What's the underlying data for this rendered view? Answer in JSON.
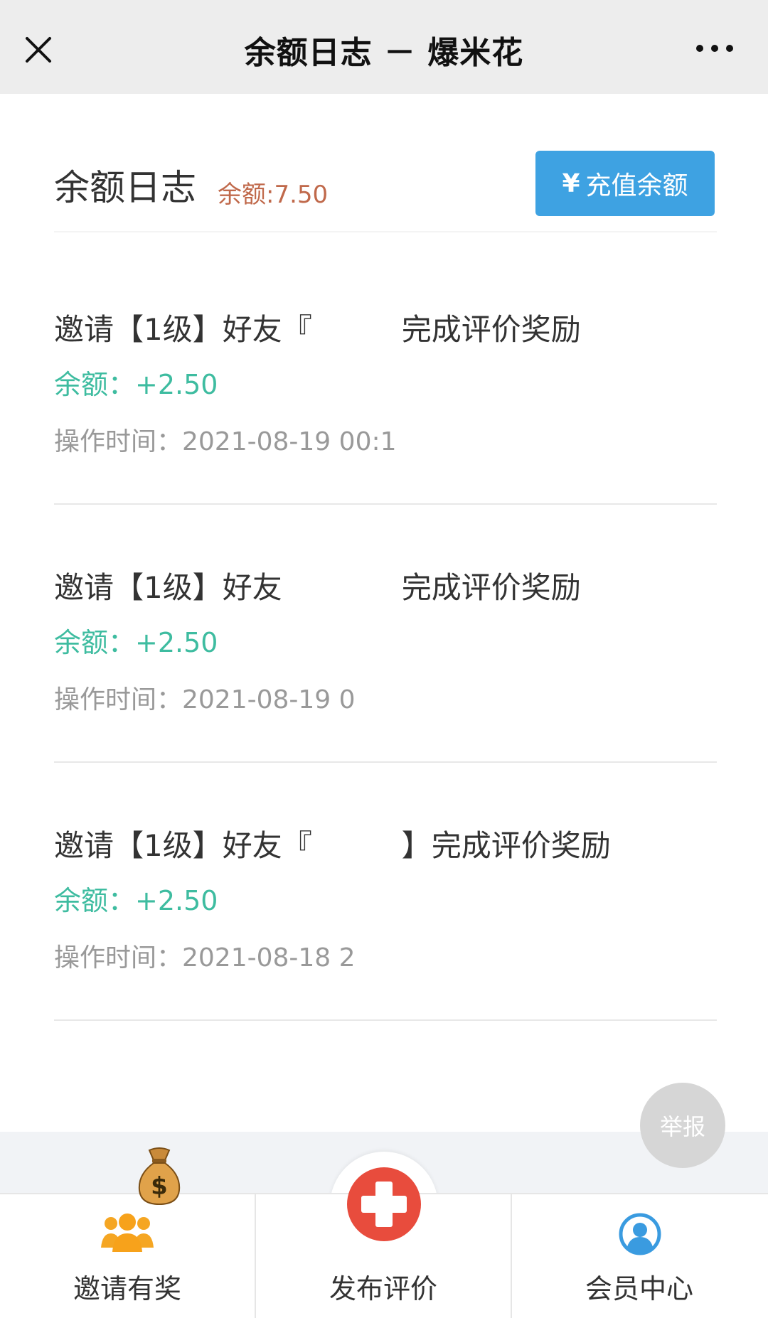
{
  "titlebar": {
    "title": "余额日志 － 爆米花",
    "close_icon": "close-icon",
    "more_icon": "more-dots-icon"
  },
  "header": {
    "heading": "余额日志",
    "balance": "余额:7.50",
    "recharge_symbol": "¥",
    "recharge_label": "充值余额"
  },
  "logs": [
    {
      "title": "邀请【1级】好友『　　　完成评价奖励",
      "amount": "余额：+2.50",
      "time": "操作时间：2021-08-19 00:1"
    },
    {
      "title": "邀请【1级】好友　　　　完成评价奖励",
      "amount": "余额：+2.50",
      "time": "操作时间：2021-08-19 0"
    },
    {
      "title": "邀请【1级】好友『　　　】完成评价奖励",
      "amount": "余额：+2.50",
      "time": "操作时间：2021-08-18 2"
    }
  ],
  "report_label": "举报",
  "tabbar": {
    "invite": "邀请有奖",
    "publish": "发布评价",
    "member": "会员中心"
  },
  "colors": {
    "accent_blue": "#3ea2e2",
    "balance_orange": "#c0694b",
    "amount_green": "#3ebca0",
    "publish_red": "#e84c3d",
    "invite_orange": "#f5a623",
    "member_blue": "#3a9be0"
  }
}
